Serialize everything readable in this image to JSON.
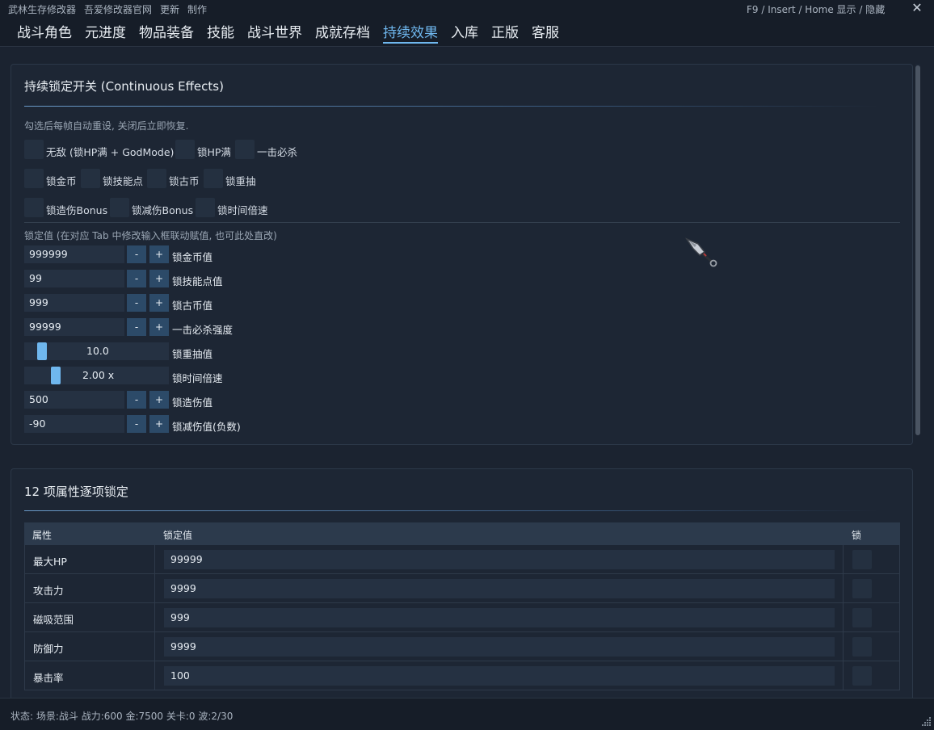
{
  "titlebar": {
    "menu": [
      "武林生存修改器",
      "吾爱修改器官网",
      "更新",
      "制作"
    ],
    "hotkey_hint": "F9 / Insert / Home  显示 / 隐藏",
    "close": "✕"
  },
  "tabs": [
    "战斗角色",
    "元进度",
    "物品装备",
    "技能",
    "战斗世界",
    "成就存档",
    "持续效果",
    "入库",
    "正版",
    "客服"
  ],
  "active_tab": "持续效果",
  "continuous": {
    "title": "持续锁定开关 (Continuous Effects)",
    "hint": "勾选后每帧自动重设, 关闭后立即恢复.",
    "checks": [
      "无敌 (锁HP满 + GodMode)",
      "锁HP满",
      "一击必杀",
      "锁金币",
      "锁技能点",
      "锁古币",
      "锁重抽",
      "锁造伤Bonus",
      "锁减伤Bonus",
      "锁时间倍速"
    ],
    "values_hint": "锁定值 (在对应 Tab 中修改输入框联动赋值, 也可此处直改)",
    "minus": "-",
    "plus": "+",
    "rows": [
      {
        "value": "999999",
        "label": "锁金币值"
      },
      {
        "value": "99",
        "label": "锁技能点值"
      },
      {
        "value": "999",
        "label": "锁古币值"
      },
      {
        "value": "99999",
        "label": "一击必杀强度"
      },
      {
        "value": "10.0",
        "label": "锁重抽值"
      },
      {
        "value": "2.00 x",
        "label": "锁时间倍速"
      },
      {
        "value": "500",
        "label": "锁造伤值"
      },
      {
        "value": "-90",
        "label": "锁减伤值(负数)"
      }
    ]
  },
  "attributes": {
    "title": "12 项属性逐项锁定",
    "headers": [
      "属性",
      "锁定值",
      "锁"
    ],
    "rows": [
      {
        "name": "最大HP",
        "value": "99999"
      },
      {
        "name": "攻击力",
        "value": "9999"
      },
      {
        "name": "磁吸范围",
        "value": "999"
      },
      {
        "name": "防御力",
        "value": "9999"
      },
      {
        "name": "暴击率",
        "value": "100"
      }
    ]
  },
  "status": "状态: 场景:战斗  战力:600  金:7500  关卡:0  波:2/30",
  "colors": {
    "accent": "#6fb7ee",
    "button": "#2c4a68",
    "field": "#253142"
  }
}
